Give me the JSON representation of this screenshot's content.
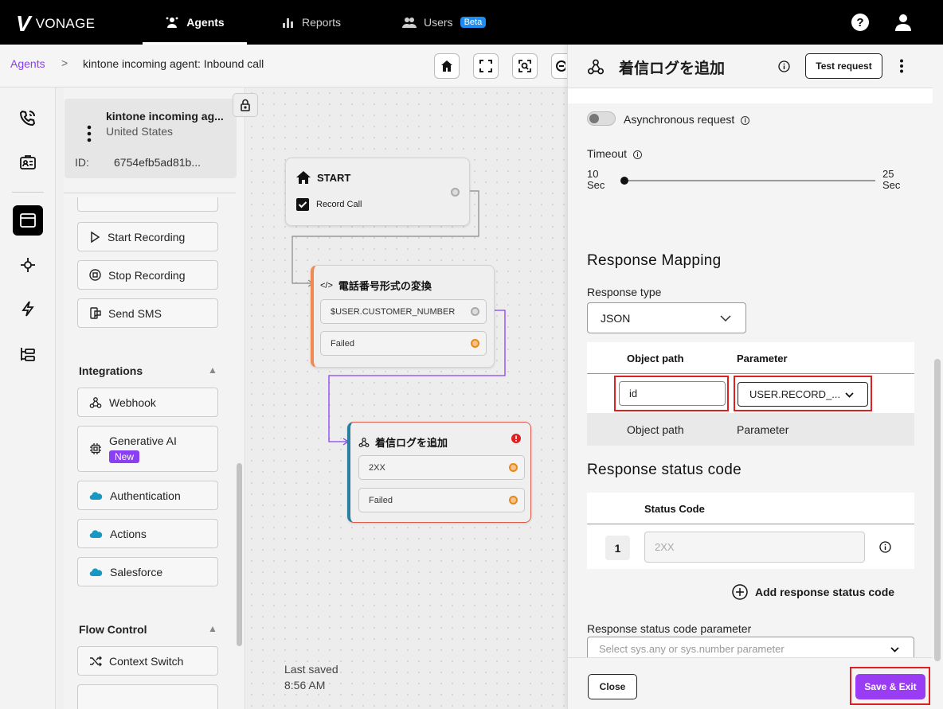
{
  "topbar": {
    "brand": "VONAGE",
    "tabs": [
      {
        "label": "Agents",
        "active": true
      },
      {
        "label": "Reports",
        "active": false
      },
      {
        "label": "Users",
        "badge": "Beta",
        "active": false
      }
    ]
  },
  "breadcrumb": {
    "root": "Agents",
    "separator": ">",
    "current": "kintone incoming agent: Inbound call"
  },
  "agent": {
    "name": "kintone incoming ag...",
    "country": "United States",
    "id_label": "ID:",
    "id_value": "6754efb5ad81b..."
  },
  "palette": {
    "actions": [
      "Start Recording",
      "Stop Recording",
      "Send SMS"
    ],
    "integrations_title": "Integrations",
    "integrations": [
      {
        "label": "Webhook",
        "icon": "webhook-icon"
      },
      {
        "label": "Generative AI",
        "icon": "chip-icon",
        "badge": "New"
      },
      {
        "label": "Authentication",
        "icon": "salesforce-cloud-icon"
      },
      {
        "label": "Actions",
        "icon": "salesforce-cloud-icon"
      },
      {
        "label": "Salesforce",
        "icon": "salesforce-cloud-icon"
      }
    ],
    "flow_control_title": "Flow Control",
    "flow_control": [
      "Context Switch"
    ]
  },
  "canvas": {
    "start_node": {
      "title": "START",
      "checkbox": "Record Call"
    },
    "convert_node": {
      "title": "電話番号形式の変換",
      "rows": [
        "$USER.CUSTOMER_NUMBER",
        "Failed"
      ]
    },
    "log_node": {
      "title": "着信ログを追加",
      "rows": [
        "2XX",
        "Failed"
      ]
    },
    "last_saved_label": "Last saved",
    "last_saved_time": "8:56 AM"
  },
  "panel": {
    "title": "着信ログを追加",
    "test_request": "Test request",
    "async_label": "Asynchronous request",
    "timeout_label": "Timeout",
    "timeout_min_value": "10",
    "timeout_min_unit": "Sec",
    "timeout_max_value": "25",
    "timeout_max_unit": "Sec",
    "timeout_value_fraction": 0.0,
    "response_mapping_title": "Response Mapping",
    "response_type_label": "Response type",
    "response_type_value": "JSON",
    "mapping_headers": {
      "object_path": "Object path",
      "parameter": "Parameter"
    },
    "mapping_row": {
      "object_path": "id",
      "parameter": "USER.RECORD_..."
    },
    "mapping_placeholder": {
      "object_path": "Object path",
      "parameter": "Parameter"
    },
    "status_code_title": "Response status code",
    "status_code_header": "Status Code",
    "status_rows": [
      {
        "index": "1",
        "placeholder": "2XX"
      }
    ],
    "add_status_code": "Add response status code",
    "status_param_label": "Response status code parameter",
    "status_param_placeholder": "Select sys.any or sys.number parameter",
    "close": "Close",
    "save_exit": "Save & Exit"
  },
  "colors": {
    "accent": "#9b3cf5",
    "link": "#8a3ff2",
    "highlight": "#e02020",
    "beta": "#1e8cf0"
  }
}
